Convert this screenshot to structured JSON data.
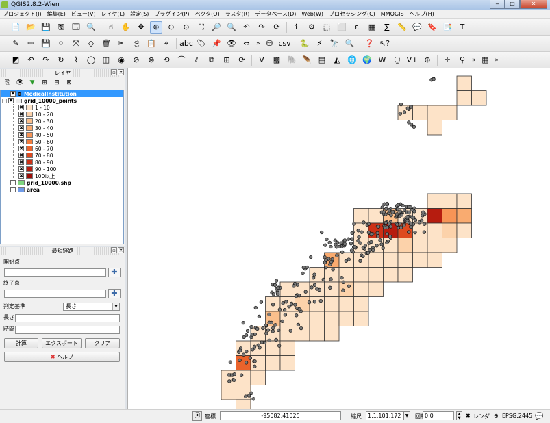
{
  "window": {
    "title": "QGIS2.8.2-Wien",
    "minimize": "‒",
    "maximize": "□",
    "close": "✕"
  },
  "menu": [
    "プロジェクト(J)",
    "編集(E)",
    "ビュー(V)",
    "レイヤ(L)",
    "設定(S)",
    "プラグイン(P)",
    "ベクタ(O)",
    "ラスタ(R)",
    "データベース(D)",
    "Web(W)",
    "プロセッシング(C)",
    "MMQGIS",
    "ヘルプ(H)"
  ],
  "toolbar_more": "»",
  "layers_panel": {
    "title": "レイヤ",
    "layers": [
      {
        "name": "MedicalInstitution",
        "checked": "✖",
        "selected": true,
        "symbol": "point"
      },
      {
        "name": "grid_10000_points",
        "checked": "✖",
        "expanded": "−"
      },
      {
        "name": "grid_10000.shp",
        "checked": "",
        "color": "#7fd67f"
      },
      {
        "name": "area",
        "checked": "",
        "color": "#6f9be8"
      }
    ],
    "classes": [
      {
        "label": "1 - 10",
        "color": "#fde3c8"
      },
      {
        "label": "10 - 20",
        "color": "#fcd2aa"
      },
      {
        "label": "20 - 30",
        "color": "#fbbf8c"
      },
      {
        "label": "30 - 40",
        "color": "#f9ab70"
      },
      {
        "label": "40 - 50",
        "color": "#f79456"
      },
      {
        "label": "50 - 60",
        "color": "#f27d3f"
      },
      {
        "label": "60 - 70",
        "color": "#ea632c"
      },
      {
        "label": "70 - 80",
        "color": "#de4a1f"
      },
      {
        "label": "80 - 90",
        "color": "#cc3116"
      },
      {
        "label": "90 - 100",
        "color": "#b61c0f"
      },
      {
        "label": "100以上",
        "color": "#9c0d08"
      }
    ]
  },
  "route_panel": {
    "title": "最短経路",
    "start_label": "開始点",
    "end_label": "終了点",
    "criterion_label": "判定基準",
    "criterion_value": "長さ",
    "length_label": "長さ",
    "time_label": "時間",
    "calc_button": "計算",
    "export_button": "エクスポート",
    "clear_button": "クリア",
    "help_button": "ヘルプ",
    "add_icon": "✚"
  },
  "statusbar": {
    "coord_label": "座標",
    "coord_value": "-95082,41025",
    "scale_label": "縮尺",
    "scale_value": "1:1,101,172",
    "rotation_label": "回転",
    "rotation_value": "0.0",
    "render_label": "レンダ",
    "render_checked": "✖",
    "crs_label": "EPSG:2445"
  },
  "colors": {
    "grid_fill": "#fdd9b5",
    "grid_stroke": "#333333",
    "point_fill": "#777777",
    "selection": "#3399ff"
  }
}
